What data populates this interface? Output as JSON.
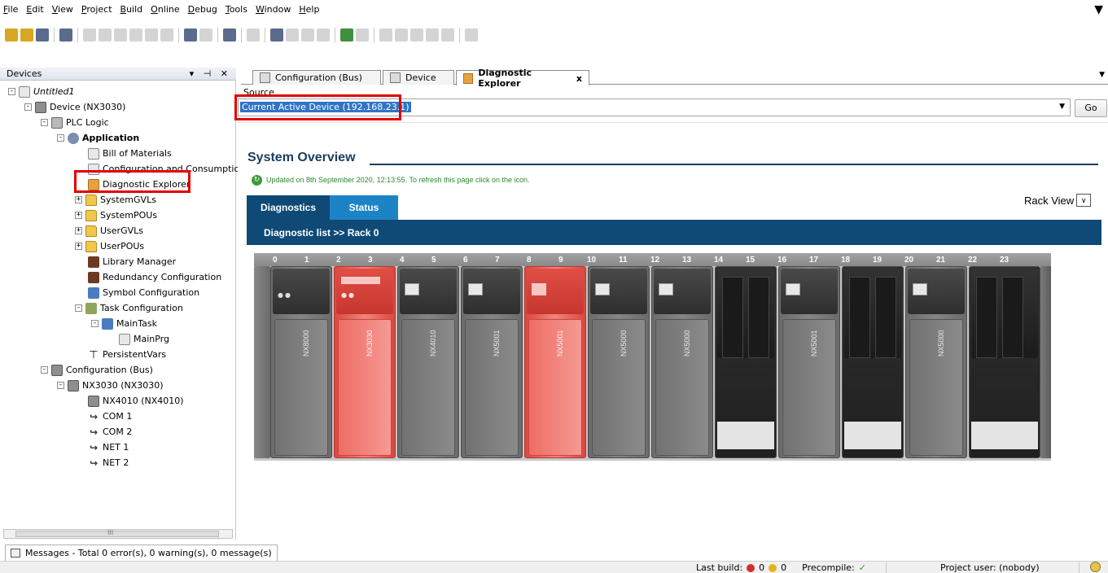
{
  "menu": [
    "File",
    "Edit",
    "View",
    "Project",
    "Build",
    "Online",
    "Debug",
    "Tools",
    "Window",
    "Help"
  ],
  "devices_panel": {
    "title": "Devices",
    "controls": "▾ ⊣ ✕",
    "tree": [
      {
        "label": "Untitled1",
        "icon": "project-icon"
      },
      {
        "label": "Device (NX3030)",
        "icon": "device-icon"
      },
      {
        "label": "PLC Logic",
        "icon": "plc-logic-icon"
      },
      {
        "label": "Application",
        "icon": "application-gear-icon"
      },
      {
        "label": "Bill of Materials",
        "icon": "document-icon"
      },
      {
        "label": "Configuration and Consumption",
        "icon": "document-icon"
      },
      {
        "label": "Diagnostic Explorer",
        "icon": "diagnostic-icon"
      },
      {
        "label": "SystemGVLs",
        "icon": "folder-icon"
      },
      {
        "label": "SystemPOUs",
        "icon": "folder-icon"
      },
      {
        "label": "UserGVLs",
        "icon": "folder-icon"
      },
      {
        "label": "UserPOUs",
        "icon": "folder-icon"
      },
      {
        "label": "Library Manager",
        "icon": "library-icon"
      },
      {
        "label": "Redundancy Configuration",
        "icon": "redundancy-icon"
      },
      {
        "label": "Symbol Configuration",
        "icon": "symbol-config-icon"
      },
      {
        "label": "Task Configuration",
        "icon": "task-config-icon"
      },
      {
        "label": "MainTask",
        "icon": "task-icon"
      },
      {
        "label": "MainPrg",
        "icon": "program-icon"
      },
      {
        "label": "PersistentVars",
        "icon": "persistent-vars-icon"
      },
      {
        "label": "Configuration (Bus)",
        "icon": "bus-config-icon"
      },
      {
        "label": "NX3030 (NX3030)",
        "icon": "device-icon"
      },
      {
        "label": "NX4010 (NX4010)",
        "icon": "device-icon"
      },
      {
        "label": "COM 1",
        "icon": "com-port-icon"
      },
      {
        "label": "COM 2",
        "icon": "com-port-icon"
      },
      {
        "label": "NET 1",
        "icon": "net-port-icon"
      },
      {
        "label": "NET 2",
        "icon": "net-port-icon"
      }
    ],
    "scroll_mark": "III"
  },
  "tabs": [
    {
      "label": "Configuration (Bus)"
    },
    {
      "label": "Device"
    },
    {
      "label": "Diagnostic Explorer",
      "close": "x"
    }
  ],
  "source": {
    "label": "Source",
    "value": "Current Active Device (192.168.23.1)",
    "go_label": "Go"
  },
  "page": {
    "title": "System Overview",
    "updated": "Updated on 8th September 2020, 12:13:55. To refresh this page click on the icon.",
    "tab_diagnostics": "Diagnostics",
    "tab_status": "Status",
    "rack_view": "Rack View",
    "diag_path": "Diagnostic list >> Rack 0"
  },
  "rack": {
    "slots": [
      "0",
      "1",
      "2",
      "3",
      "4",
      "5",
      "6",
      "7",
      "8",
      "9",
      "10",
      "11",
      "12",
      "13",
      "14",
      "15",
      "16",
      "17",
      "18",
      "19",
      "20",
      "21",
      "22",
      "23"
    ],
    "modules": [
      {
        "label": "NX8000",
        "state": "normal"
      },
      {
        "label": "NX3030",
        "state": "error"
      },
      {
        "label": "NX4010",
        "state": "normal"
      },
      {
        "label": "NX5001",
        "state": "normal"
      },
      {
        "label": "NX5001",
        "state": "error"
      },
      {
        "label": "NX5000",
        "state": "normal"
      },
      {
        "label": "NX5000",
        "state": "normal"
      },
      {
        "label": "",
        "state": "empty"
      },
      {
        "label": "NX5001",
        "state": "normal"
      },
      {
        "label": "",
        "state": "empty"
      },
      {
        "label": "NX5000",
        "state": "normal"
      },
      {
        "label": "",
        "state": "empty"
      }
    ]
  },
  "messages": "Messages - Total 0 error(s), 0 warning(s), 0 message(s)",
  "statusbar": {
    "last_build": "Last build:",
    "errors": "0",
    "warnings": "0",
    "precompile": "Precompile:",
    "project_user": "Project user: (nobody)"
  },
  "colors": {
    "header_blue": "#0e4a75",
    "status_tab_blue": "#1c84c6",
    "error_red": "#e04f46",
    "highlight_red": "#e10000",
    "title_navy": "#1b3d5e"
  }
}
